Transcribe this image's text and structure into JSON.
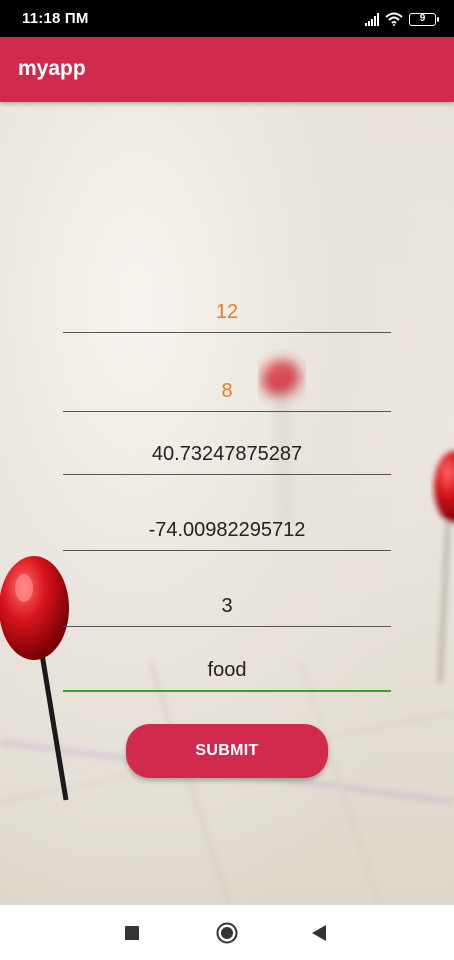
{
  "status_bar": {
    "time": "11:18 ПМ",
    "battery_level": "9",
    "icons": [
      "signal-icon",
      "wifi-icon",
      "battery-icon"
    ]
  },
  "app_bar": {
    "title": "myapp",
    "color": "#d22a4c"
  },
  "form": {
    "fields": [
      {
        "value": "12",
        "style": "hint",
        "color": "#f07d1a"
      },
      {
        "value": "8",
        "style": "hint",
        "color": "#f07d1a"
      },
      {
        "value": "40.73247875287",
        "style": "text"
      },
      {
        "value": "-74.00982295712",
        "style": "text"
      },
      {
        "value": "3",
        "style": "text"
      },
      {
        "value": "food",
        "style": "text",
        "focused": true,
        "underline_color": "#37a12b"
      }
    ],
    "submit_label": "SUBMIT"
  },
  "nav_bar": {
    "buttons": [
      "recents-square-icon",
      "home-circle-icon",
      "back-triangle-icon"
    ]
  }
}
